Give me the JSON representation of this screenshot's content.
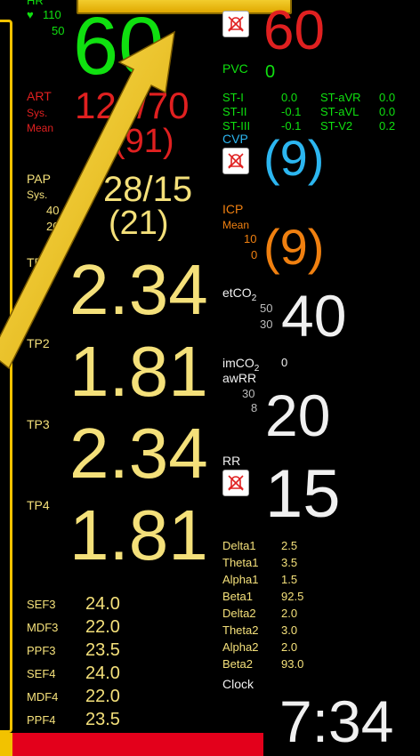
{
  "hr": {
    "label": "HR",
    "limit_high": "110",
    "limit_low": "50",
    "value": "60"
  },
  "right_top": {
    "value": "60"
  },
  "pvc": {
    "label": "PVC",
    "value": "0"
  },
  "st": [
    {
      "l1": "ST-I",
      "v1": "0.0",
      "l2": "ST-aVR",
      "v2": "0.0"
    },
    {
      "l1": "ST-II",
      "v1": "-0.1",
      "l2": "ST-aVL",
      "v2": "0.0"
    },
    {
      "l1": "ST-III",
      "v1": "-0.1",
      "l2": "ST-V2",
      "v2": "0.2"
    }
  ],
  "art": {
    "label": "ART",
    "sub1": "Sys.",
    "sub2": "Mean",
    "value": "120/70",
    "mean": "(91)"
  },
  "cvp": {
    "label": "CVP",
    "value": "(9)"
  },
  "pap": {
    "label": "PAP",
    "sub1": "Sys.",
    "limit_high": "40",
    "limit_low": "20",
    "value": "28/15",
    "mean": "(21)"
  },
  "icp": {
    "label": "ICP",
    "sub1": "Mean",
    "limit_high": "10",
    "limit_low": "0",
    "value": "(9)"
  },
  "tp": [
    {
      "label": "TP1",
      "value": "2.34"
    },
    {
      "label": "TP2",
      "value": "1.81"
    },
    {
      "label": "TP3",
      "value": "2.34"
    },
    {
      "label": "TP4",
      "value": "1.81"
    }
  ],
  "etco2": {
    "label": "etCO",
    "sub": "2",
    "limit_high": "50",
    "limit_low": "30",
    "value": "40"
  },
  "imco2": {
    "label": "imCO",
    "sub": "2",
    "value": "0",
    "label2": "awRR",
    "limit_high": "30",
    "limit_low": "8",
    "rr_value": "20"
  },
  "rr": {
    "label": "RR",
    "value": "15"
  },
  "eeg_left": [
    {
      "label": "SEF3",
      "value": "24.0"
    },
    {
      "label": "MDF3",
      "value": "22.0"
    },
    {
      "label": "PPF3",
      "value": "23.5"
    },
    {
      "label": "SEF4",
      "value": "24.0"
    },
    {
      "label": "MDF4",
      "value": "22.0"
    },
    {
      "label": "PPF4",
      "value": "23.5"
    }
  ],
  "eeg_right": [
    {
      "label": "Delta1",
      "value": "2.5"
    },
    {
      "label": "Theta1",
      "value": "3.5"
    },
    {
      "label": "Alpha1",
      "value": "1.5"
    },
    {
      "label": "Beta1",
      "value": "92.5"
    },
    {
      "label": "Delta2",
      "value": "2.0"
    },
    {
      "label": "Theta2",
      "value": "3.0"
    },
    {
      "label": "Alpha2",
      "value": "2.0"
    },
    {
      "label": "Beta2",
      "value": "93.0"
    }
  ],
  "clock": {
    "label": "Clock",
    "value": "7:34"
  },
  "icons": {
    "alarm_off": "alarm-off-icon",
    "pointer": "arrow-pointer-icon"
  },
  "colors": {
    "hr": "#10e010",
    "art": "#e02020",
    "yellow": "#f4e07a",
    "cvp": "#2cb6f0",
    "icp": "#f08010",
    "frame": "#f2c200"
  }
}
